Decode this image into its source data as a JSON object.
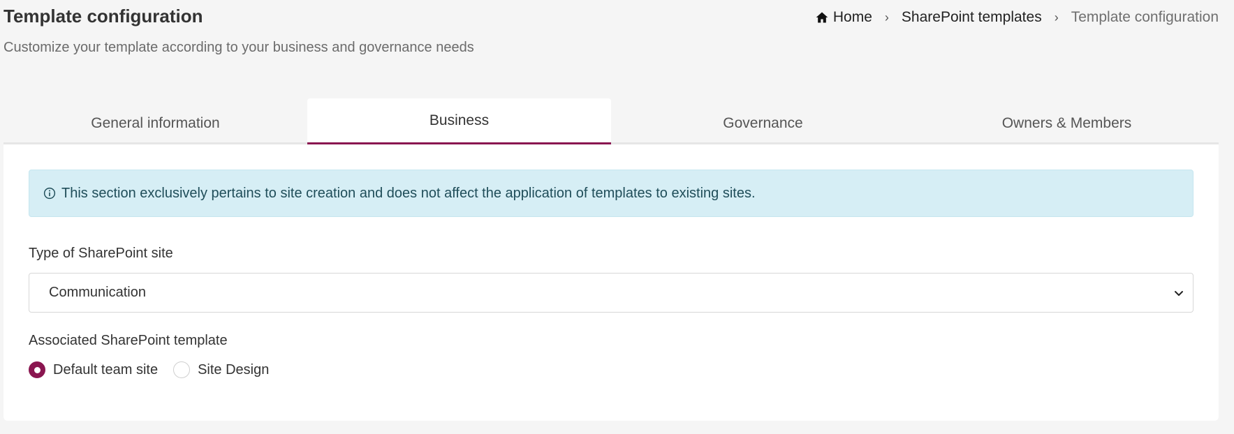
{
  "header": {
    "title": "Template configuration",
    "subtitle": "Customize your template according to your business and governance needs"
  },
  "breadcrumb": {
    "home_icon": "home-icon",
    "home": "Home",
    "separator_icon": "chevron-right-icon",
    "items": [
      "SharePoint templates",
      "Template configuration"
    ]
  },
  "tabs": [
    {
      "label": "General information",
      "active": false
    },
    {
      "label": "Business",
      "active": true
    },
    {
      "label": "Governance",
      "active": false
    },
    {
      "label": "Owners & Members",
      "active": false
    }
  ],
  "alert": {
    "icon": "info-icon",
    "text": "This section exclusively pertains to site creation and does not affect the application of templates to existing sites."
  },
  "site_type": {
    "label": "Type of SharePoint site",
    "selected": "Communication"
  },
  "associated_template": {
    "label": "Associated SharePoint template",
    "options": [
      {
        "label": "Default team site",
        "checked": true
      },
      {
        "label": "Site Design",
        "checked": false
      }
    ]
  },
  "colors": {
    "accent": "#8a1650",
    "alert_bg": "#d6eef5",
    "page_bg": "#f5f5f5"
  }
}
